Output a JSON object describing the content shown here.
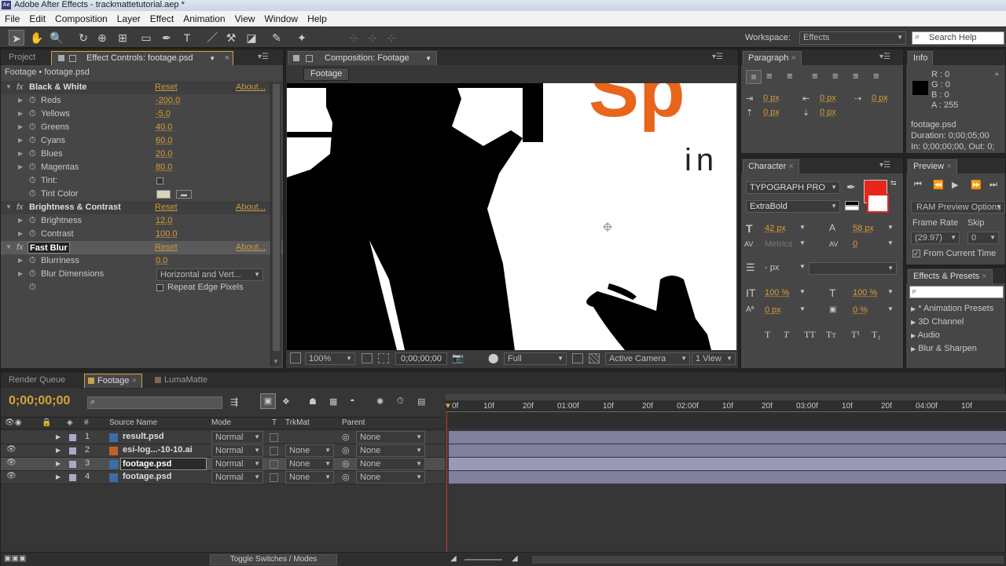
{
  "window": {
    "title": "Adobe After Effects - trackmattetutorial.aep *",
    "app_icon": "Ae"
  },
  "menu": [
    "File",
    "Edit",
    "Composition",
    "Layer",
    "Effect",
    "Animation",
    "View",
    "Window",
    "Help"
  ],
  "toolbar": {
    "workspace_label": "Workspace:",
    "workspace_value": "Effects",
    "search_placeholder": "Search Help"
  },
  "left_panel": {
    "tab_project": "Project",
    "tab_effect_controls": "Effect Controls: footage.psd",
    "breadcrumb": "Footage • footage.psd",
    "effects": [
      {
        "name": "Black & White",
        "reset": "Reset",
        "about": "About...",
        "props": [
          {
            "label": "Reds",
            "value": "-200.0"
          },
          {
            "label": "Yellows",
            "value": "-5.0"
          },
          {
            "label": "Greens",
            "value": "40.0"
          },
          {
            "label": "Cyans",
            "value": "60.0"
          },
          {
            "label": "Blues",
            "value": "20.0"
          },
          {
            "label": "Magentas",
            "value": "80.0"
          },
          {
            "label": "Tint:",
            "value": ""
          },
          {
            "label": "Tint Color",
            "value": ""
          }
        ]
      },
      {
        "name": "Brightness & Contrast",
        "reset": "Reset",
        "about": "About...",
        "props": [
          {
            "label": "Brightness",
            "value": "12.0"
          },
          {
            "label": "Contrast",
            "value": "100.0"
          }
        ]
      },
      {
        "name": "Fast Blur",
        "reset": "Reset",
        "about": "About...",
        "props": [
          {
            "label": "Blurriness",
            "value": "0.0"
          },
          {
            "label": "Blur Dimensions",
            "value": "Horizontal and Vert..."
          },
          {
            "label": "",
            "value": "Repeat Edge Pixels"
          }
        ]
      }
    ]
  },
  "comp_panel": {
    "tab": "Composition: Footage",
    "subtab": "Footage",
    "overlay_text_big": "Sp",
    "overlay_text_small": "in",
    "footer": {
      "zoom": "100%",
      "timecode": "0;00;00;00",
      "resolution": "Full",
      "camera": "Active Camera",
      "views": "1 View"
    }
  },
  "paragraph": {
    "tab": "Paragraph",
    "fields": [
      "0 px",
      "0 px",
      "0 px",
      "0 px",
      "0 px"
    ]
  },
  "info": {
    "tab": "Info",
    "r": "R : 0",
    "g": "G : 0",
    "b": "B : 0",
    "a": "A : 255",
    "file": "footage.psd",
    "duration": "Duration: 0;00;05;00",
    "inout": "In: 0;00;00;00, Out: 0;"
  },
  "character": {
    "tab": "Character",
    "font": "TYPOGRAPH PRO",
    "style": "ExtraBold",
    "size": "42 px",
    "leading": "58 px",
    "kerning": "Metrics",
    "tracking": "0",
    "indent": "- px",
    "vscale": "100 %",
    "hscale": "100 %",
    "baseline": "0 px",
    "tsume": "0 %",
    "fill_color": "#e8261c"
  },
  "preview": {
    "tab": "Preview",
    "ram": "RAM Preview Options",
    "frame_rate_label": "Frame Rate",
    "skip_label": "Skip",
    "frame_rate": "(29.97)",
    "skip": "0",
    "from_current": "From Current Time"
  },
  "effects_presets": {
    "tab": "Effects & Presets",
    "items": [
      "* Animation Presets",
      "3D Channel",
      "Audio",
      "Blur & Sharpen"
    ]
  },
  "timeline": {
    "tabs": [
      "Render Queue",
      "Footage",
      "LumaMatte"
    ],
    "timecode": "0;00;00;00",
    "headers": {
      "source": "Source Name",
      "mode": "Mode",
      "t": "T",
      "trkmat": "TrkMat",
      "parent": "Parent"
    },
    "ruler": [
      "0f",
      "10f",
      "20f",
      "01:00f",
      "10f",
      "20f",
      "02:00f",
      "10f",
      "20f",
      "03:00f",
      "10f",
      "20f",
      "04:00f",
      "10f"
    ],
    "layers": [
      {
        "num": "1",
        "name": "result.psd",
        "mode": "Normal",
        "trkmat": "",
        "parent": "None"
      },
      {
        "num": "2",
        "name": "esi-log...-10-10.ai",
        "mode": "Normal",
        "trkmat": "None",
        "parent": "None"
      },
      {
        "num": "3",
        "name": "footage.psd",
        "mode": "Normal",
        "trkmat": "None",
        "parent": "None"
      },
      {
        "num": "4",
        "name": "footage.psd",
        "mode": "Normal",
        "trkmat": "None",
        "parent": "None"
      }
    ],
    "footer": "Toggle Switches / Modes"
  }
}
